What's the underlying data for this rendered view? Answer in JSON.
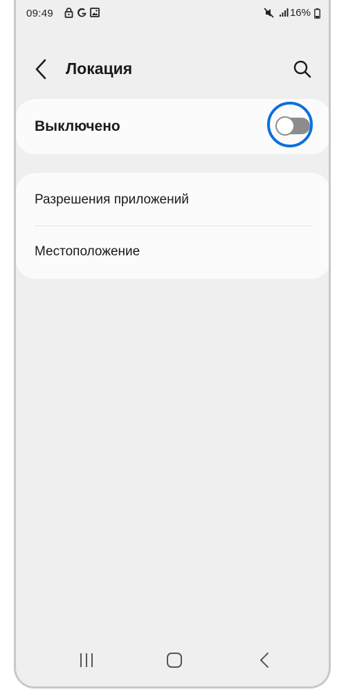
{
  "status_bar": {
    "time": "09:49",
    "left_icons": [
      "lock-icon",
      "google-icon",
      "image-icon"
    ],
    "right_icons": [
      "mute-icon",
      "signal-icon",
      "battery-icon"
    ],
    "battery": "16%"
  },
  "header": {
    "title": "Локация",
    "back_icon": "chevron-left-icon",
    "search_icon": "search-icon"
  },
  "location_toggle": {
    "label": "Выключено",
    "state": "off",
    "highlight_color": "#0d6fe0"
  },
  "settings_list": {
    "items": [
      {
        "label": "Разрешения приложений"
      },
      {
        "label": "Местоположение"
      }
    ]
  },
  "nav_bar": {
    "buttons": [
      "recents-icon",
      "home-icon",
      "back-icon"
    ]
  },
  "colors": {
    "background": "#efefef",
    "card": "#fbfbfb",
    "toggle_off": "#8c8c8c",
    "accent": "#0d6fe0"
  }
}
